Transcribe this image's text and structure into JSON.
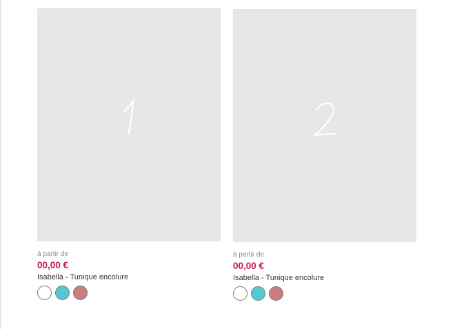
{
  "products": [
    {
      "placeholder_number": "1",
      "price_prefix": "à partir de",
      "price": "00,00 €",
      "name": "Isabella - Tunique encolure",
      "swatches": [
        "#ffffff",
        "#56c8d4",
        "#c97f7e"
      ]
    },
    {
      "placeholder_number": "2",
      "price_prefix": "à partir de",
      "price": "00,00 €",
      "name": "Isabella - Tunique encolure",
      "swatches": [
        "#ffffff",
        "#56c8d4",
        "#c97f7e"
      ]
    }
  ]
}
